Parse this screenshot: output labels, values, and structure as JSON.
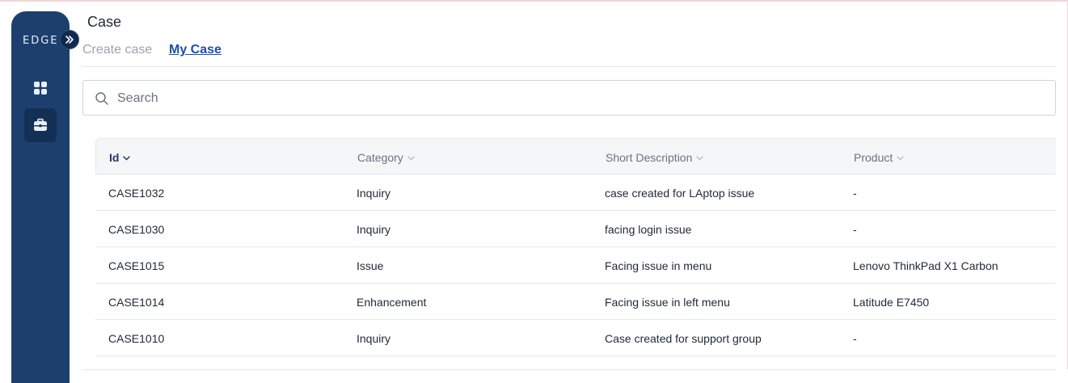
{
  "sidebar": {
    "logo_text": "EDGE",
    "expand_icon": "chevrons-right-icon",
    "items": [
      {
        "icon": "dashboard-grid-icon",
        "active": false
      },
      {
        "icon": "briefcase-icon",
        "active": true
      }
    ]
  },
  "page": {
    "title": "Case",
    "tabs": [
      {
        "label": "Create case",
        "active": false
      },
      {
        "label": "My Case",
        "active": true
      }
    ]
  },
  "search": {
    "placeholder": "Search",
    "value": "",
    "icon": "search-icon"
  },
  "table": {
    "columns": [
      {
        "label": "Id",
        "sorted": true
      },
      {
        "label": "Category",
        "sorted": false
      },
      {
        "label": "Short Description",
        "sorted": false
      },
      {
        "label": "Product",
        "sorted": false
      }
    ],
    "rows": [
      [
        "CASE1032",
        "Inquiry",
        "case created for LAptop issue",
        "-"
      ],
      [
        "CASE1030",
        "Inquiry",
        "facing login issue",
        "-"
      ],
      [
        "CASE1015",
        "Issue",
        "Facing issue in menu",
        "Lenovo ThinkPad X1 Carbon"
      ],
      [
        "CASE1014",
        "Enhancement",
        "Facing issue in left menu",
        "Latitude E7450"
      ],
      [
        "CASE1010",
        "Inquiry",
        "Case created for support group",
        "-"
      ]
    ]
  },
  "colors": {
    "sidebar_bg": "#1d3f6e",
    "active_nav_bg": "#132f55",
    "accent_link": "#1d4ea8",
    "header_bg": "#f5f6f8"
  }
}
